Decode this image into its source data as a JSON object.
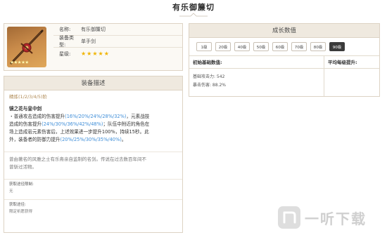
{
  "page": {
    "title": "有乐御簾切"
  },
  "info": {
    "rows": [
      {
        "key": "名称:",
        "value": "有乐御簾切"
      },
      {
        "key": "装备类型:",
        "value": "单手剑"
      },
      {
        "key": "星级:",
        "value": ""
      }
    ],
    "rarity_stars": "★★★★★",
    "icon_stars": "★★★★★"
  },
  "description": {
    "header": "装备描述",
    "refine": "精炼(1/2/3/4/5)阶",
    "skill_name": "镜之花与皇中剑",
    "skill_lines": [
      {
        "parts": [
          {
            "t": "・普通攻击造成的伤害提升",
            "h": false
          },
          {
            "t": "(16%/20%/24%/28%/32%)",
            "h": true
          },
          {
            "t": "，元素战技",
            "h": false
          }
        ]
      },
      {
        "parts": [
          {
            "t": "造成的伤害提升",
            "h": false
          },
          {
            "t": "(24%/30%/36%/42%/48%)",
            "h": true
          },
          {
            "t": "；队伍中附近的角色在",
            "h": false
          }
        ]
      },
      {
        "parts": [
          {
            "t": "场上造成岩元素伤害后，上述效果进一步提升100%，持续15秒。此",
            "h": false
          }
        ]
      },
      {
        "parts": [
          {
            "t": "外，装备者的防御力提升",
            "h": false
          },
          {
            "t": "(20%/25%/30%/35%/40%)",
            "h": true
          },
          {
            "t": "。",
            "h": false
          }
        ]
      }
    ],
    "lore_lines": [
      "曾由著名的风雅之士有乐斋亲自监制的名剑。传说在过去数百年间不",
      "曾斩过活物。"
    ],
    "meta": [
      {
        "label": "获取途径限制:",
        "value": "无"
      },
      {
        "label": "获取途径:",
        "value": "限定祈愿获得"
      }
    ]
  },
  "growth": {
    "header": "成长数值",
    "levels": [
      "1级",
      "20级",
      "40级",
      "50级",
      "60级",
      "70级",
      "80级",
      "90级"
    ],
    "active_level": "90级",
    "col_base": "初始基础数值:",
    "col_avg": "平均每级提升:",
    "stats": [
      "基础攻击力: 542",
      "暴击伤害: 88.2%"
    ]
  },
  "watermark": {
    "text": "一听下载"
  }
}
